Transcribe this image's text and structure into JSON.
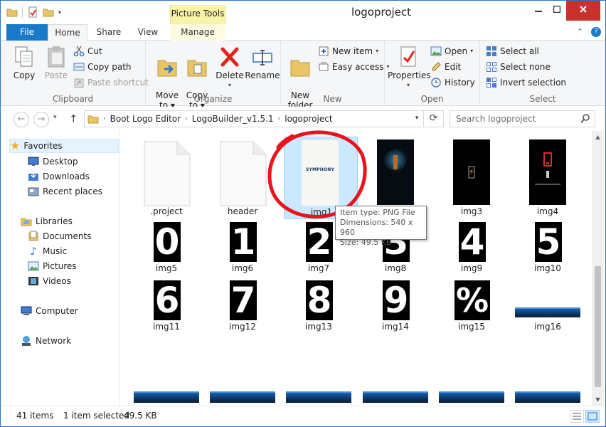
{
  "window": {
    "title": "logoproject",
    "context_tab_header": "Picture Tools"
  },
  "ribbon_tabs": [
    "File",
    "Home",
    "Share",
    "View",
    "Manage"
  ],
  "ribbon": {
    "clipboard": {
      "label": "Clipboard",
      "copy": "Copy",
      "paste": "Paste",
      "cut": "Cut",
      "copy_path": "Copy path",
      "paste_shortcut": "Paste shortcut"
    },
    "organize": {
      "label": "Organize",
      "move_to": "Move\nto ▾",
      "copy_to": "Copy\nto ▾",
      "delete": "Delete",
      "rename": "Rename"
    },
    "new": {
      "label": "New",
      "new_folder": "New\nfolder",
      "new_item": "New item",
      "easy_access": "Easy access"
    },
    "open": {
      "label": "Open",
      "properties": "Properties",
      "open": "Open",
      "edit": "Edit",
      "history": "History"
    },
    "select": {
      "label": "Select",
      "select_all": "Select all",
      "select_none": "Select none",
      "invert_selection": "Invert selection"
    }
  },
  "address": {
    "crumbs": [
      "Boot Logo Editor",
      "LogoBuilder_v1.5.1",
      "logoproject"
    ],
    "search_placeholder": "Search logoproject"
  },
  "nav": {
    "favorites": "Favorites",
    "desktop": "Desktop",
    "downloads": "Downloads",
    "recent_places": "Recent places",
    "libraries": "Libraries",
    "documents": "Documents",
    "music": "Music",
    "pictures": "Pictures",
    "videos": "Videos",
    "computer": "Computer",
    "network": "Network"
  },
  "files": {
    "row1": [
      ".project",
      "header",
      "img1",
      "img2",
      "img3",
      "img4"
    ],
    "row2": [
      "img5",
      "img6",
      "img7",
      "img8",
      "img9",
      "img10"
    ],
    "row2_digits": [
      "0",
      "1",
      "2",
      "3",
      "4",
      "5"
    ],
    "row3": [
      "img11",
      "img12",
      "img13",
      "img14",
      "img15",
      "img16"
    ],
    "row3_digits": [
      "6",
      "7",
      "8",
      "9",
      "%",
      ""
    ],
    "img1_logo_text": "SYMPHONY"
  },
  "tooltip": {
    "type": "Item type: PNG File",
    "dimensions": "Dimensions: 540 x 960",
    "size": "Size: 49.5 KB"
  },
  "status": {
    "count": "41 items",
    "selected": "1 item selected",
    "size": "49.5 KB"
  },
  "colors": {
    "file_tab": "#1979ca",
    "context_tab": "#f9f3a7",
    "selection": "#cce8ff",
    "annotation_circle": "#e8141b"
  }
}
